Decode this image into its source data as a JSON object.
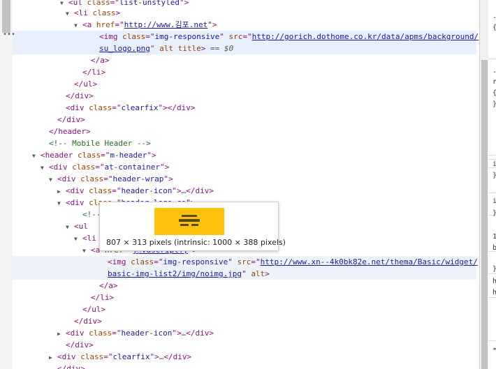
{
  "elements_panel": {
    "rows": [
      {
        "parts": [
          [
            "tag",
            "<ul "
          ],
          [
            "an",
            "class"
          ],
          [
            "tag",
            "=\""
          ],
          [
            "av",
            "list-unstyled"
          ],
          [
            "tag",
            "\">"
          ]
        ]
      },
      {
        "parts": [
          [
            "tag",
            "<li "
          ],
          [
            "an",
            "class"
          ],
          [
            "tag",
            ">"
          ]
        ]
      },
      {
        "parts": [
          [
            "tag",
            "<a "
          ],
          [
            "an",
            "href"
          ],
          [
            "tag",
            "=\""
          ],
          [
            "link",
            "http://www.김포.net"
          ],
          [
            "tag",
            "\">"
          ]
        ]
      },
      {
        "parts": [
          [
            "tag",
            "<img "
          ],
          [
            "an",
            "class"
          ],
          [
            "tag",
            "=\""
          ],
          [
            "av",
            "img-responsive"
          ],
          [
            "tag",
            "\" "
          ],
          [
            "an",
            "src"
          ],
          [
            "tag",
            "=\""
          ],
          [
            "link",
            "http://gorich.dothome.co.kr/data/apms/background/"
          ]
        ]
      },
      {
        "parts": [
          [
            "link",
            "su_logo.png"
          ],
          [
            "tag",
            "\" "
          ],
          [
            "an",
            "alt title"
          ],
          [
            "tag",
            ">"
          ],
          [
            "eq",
            " == "
          ],
          [
            "dollar",
            "$0"
          ]
        ]
      },
      {
        "parts": [
          [
            "tag",
            "</a>"
          ]
        ]
      },
      {
        "parts": [
          [
            "tag",
            "</li>"
          ]
        ]
      },
      {
        "parts": [
          [
            "tag",
            "</ul>"
          ]
        ]
      },
      {
        "parts": [
          [
            "tag",
            "</div>"
          ]
        ]
      },
      {
        "parts": [
          [
            "tag",
            "<div "
          ],
          [
            "an",
            "class"
          ],
          [
            "tag",
            "=\""
          ],
          [
            "av",
            "clearfix"
          ],
          [
            "tag",
            "\"></div>"
          ]
        ]
      },
      {
        "parts": [
          [
            "tag",
            "</div>"
          ]
        ]
      },
      {
        "parts": [
          [
            "tag",
            "</header>"
          ]
        ]
      },
      {
        "parts": [
          [
            "cm",
            "<!-- Mobile Header -->"
          ]
        ]
      },
      {
        "parts": [
          [
            "tag",
            "<header "
          ],
          [
            "an",
            "class"
          ],
          [
            "tag",
            "=\""
          ],
          [
            "av",
            "m-header"
          ],
          [
            "tag",
            "\">"
          ]
        ]
      },
      {
        "parts": [
          [
            "tag",
            "<div "
          ],
          [
            "an",
            "class"
          ],
          [
            "tag",
            "=\""
          ],
          [
            "av",
            "at-container"
          ],
          [
            "tag",
            "\">"
          ]
        ]
      },
      {
        "parts": [
          [
            "tag",
            "<div "
          ],
          [
            "an",
            "class"
          ],
          [
            "tag",
            "=\""
          ],
          [
            "av",
            "header-wrap"
          ],
          [
            "tag",
            "\">"
          ]
        ]
      },
      {
        "parts": [
          [
            "tag",
            "<div "
          ],
          [
            "an",
            "class"
          ],
          [
            "tag",
            "=\""
          ],
          [
            "av",
            "header-icon"
          ],
          [
            "tag",
            "\">"
          ],
          [
            "ell",
            "…"
          ],
          [
            "tag",
            "</div>"
          ]
        ]
      },
      {
        "parts": [
          [
            "tag",
            "<div "
          ],
          [
            "an",
            "class"
          ],
          [
            "tag",
            "=\""
          ],
          [
            "av",
            "header-logo-co"
          ],
          [
            "tag",
            "\">"
          ]
        ]
      },
      {
        "parts": [
          [
            "cm",
            "<!--"
          ]
        ]
      },
      {
        "parts": [
          [
            "tag",
            "<ul"
          ]
        ]
      },
      {
        "parts": [
          [
            "tag",
            "<li"
          ]
        ]
      },
      {
        "parts": [
          [
            "tag",
            "<a "
          ],
          [
            "an",
            "href"
          ],
          [
            "tag",
            "=\""
          ],
          [
            "link",
            "javascript:;"
          ],
          [
            "tag",
            "\">"
          ]
        ]
      },
      {
        "parts": [
          [
            "tag",
            "<img "
          ],
          [
            "an",
            "class"
          ],
          [
            "tag",
            "=\""
          ],
          [
            "av",
            "img-responsive"
          ],
          [
            "tag",
            "\" "
          ],
          [
            "an",
            "src"
          ],
          [
            "tag",
            "=\""
          ],
          [
            "link",
            "http://www.xn--4k0bk82e.net/thema/Basic/widget/"
          ]
        ]
      },
      {
        "parts": [
          [
            "link",
            "basic-img-list2/img/noimg.jpg"
          ],
          [
            "tag",
            "\" "
          ],
          [
            "an",
            "alt"
          ],
          [
            "tag",
            ">"
          ]
        ]
      },
      {
        "parts": [
          [
            "tag",
            "</a>"
          ]
        ]
      },
      {
        "parts": [
          [
            "tag",
            "</li>"
          ]
        ]
      },
      {
        "parts": [
          [
            "tag",
            "</ul>"
          ]
        ]
      },
      {
        "parts": [
          [
            "tag",
            "</div>"
          ]
        ]
      },
      {
        "parts": [
          [
            "tag",
            "<div "
          ],
          [
            "an",
            "class"
          ],
          [
            "tag",
            "=\""
          ],
          [
            "av",
            "header-icon"
          ],
          [
            "tag",
            "\">"
          ],
          [
            "ell",
            "…"
          ],
          [
            "tag",
            "</div>"
          ]
        ]
      },
      {
        "parts": [
          [
            "tag",
            "</div>"
          ]
        ]
      },
      {
        "parts": [
          [
            "tag",
            "<div "
          ],
          [
            "an",
            "class"
          ],
          [
            "tag",
            "=\""
          ],
          [
            "av",
            "clearfix"
          ],
          [
            "tag",
            "\">"
          ],
          [
            "ell",
            "…"
          ],
          [
            "tag",
            "</div>"
          ]
        ]
      },
      {
        "parts": [
          [
            "tag",
            "</div>"
          ]
        ]
      }
    ],
    "selected_marker": "•••"
  },
  "tooltip": {
    "dimensions": "807 × 313 pixels (intrinsic: 1000 × 388 pixels)",
    "thumbnail_color": "#ffc20e"
  },
  "styles_pane": {
    "chars": [
      ".",
      "{",
      ".",
      "r",
      "{",
      "}",
      "i",
      "}",
      "i",
      "}",
      "1",
      "b",
      "}",
      "h",
      "h",
      "*"
    ]
  },
  "colors": {
    "tag": "#881280",
    "attr_name": "#994500",
    "attr_value": "#1a1aa6",
    "comment": "#236e25",
    "selected_row": "#e8f0fe"
  }
}
